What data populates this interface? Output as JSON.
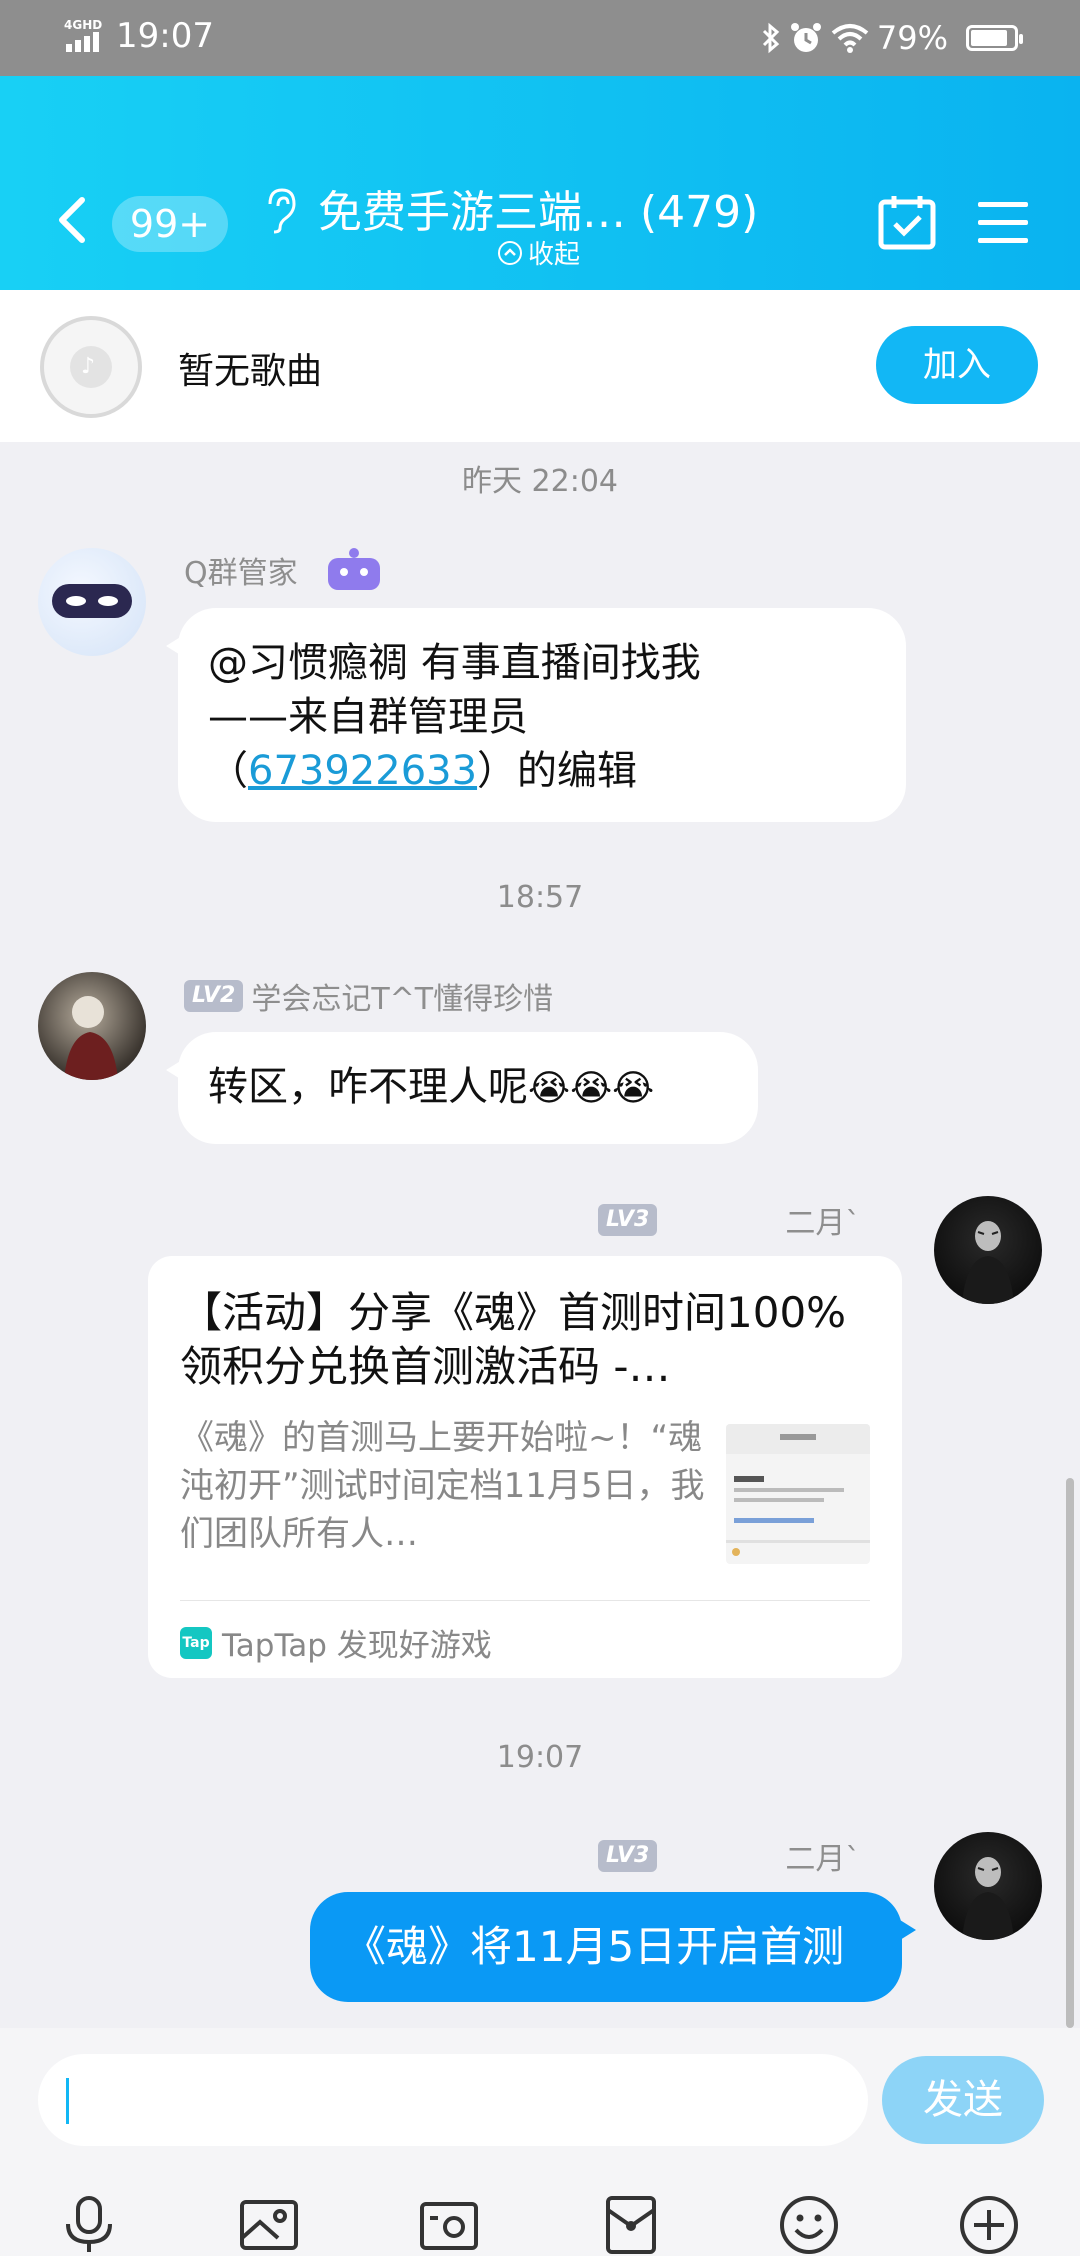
{
  "status_bar": {
    "network": "4GHD",
    "time": "19:07",
    "battery_pct": "79%"
  },
  "header": {
    "unread_badge": "99+",
    "group_name": "免费手游三端… (479)",
    "collapse_label": "收起"
  },
  "music": {
    "label": "暂无歌曲",
    "join_label": "加入"
  },
  "messages": {
    "ts1": "昨天 22:04",
    "m1_sender": "Q群管家",
    "m1_line1": "@习惯瘾禂 有事直播间找我",
    "m1_line2": "——来自群管理员",
    "m1_line3_pre": "（",
    "m1_link": "673922633",
    "m1_line3_post": "）的编辑",
    "ts2": "18:57",
    "m2_level": "LV2",
    "m2_sender": "学会忘记T^T懂得珍惜",
    "m2_text": "转区，咋不理人呢",
    "m2_emojis": "😭😭😭",
    "m3_level": "LV3",
    "m3_sender": "二月`",
    "card_title": "【活动】分享《魂》首测时间100%领积分兑换首测激活码 -…",
    "card_desc": "《魂》的首测马上要开始啦~！“魂沌初开”测试时间定档11月5日，我们团队所有人…",
    "card_source": "TapTap 发现好游戏",
    "card_tap_icon": "Tap",
    "ts3": "19:07",
    "m4_level": "LV3",
    "m4_sender": "二月`",
    "m4_text": "《魂》将11月5日开启首测"
  },
  "input": {
    "send_label": "发送"
  },
  "icons": {
    "toolbar": [
      "microphone-icon",
      "photo-icon",
      "camera-icon",
      "red-packet-icon",
      "emoji-icon",
      "plus-icon"
    ]
  },
  "colors": {
    "header_start": "#18d0f5",
    "header_end": "#0ab3f0",
    "accent": "#12b7f5",
    "my_bubble": "#0a99f5",
    "link": "#1a9bd7"
  }
}
